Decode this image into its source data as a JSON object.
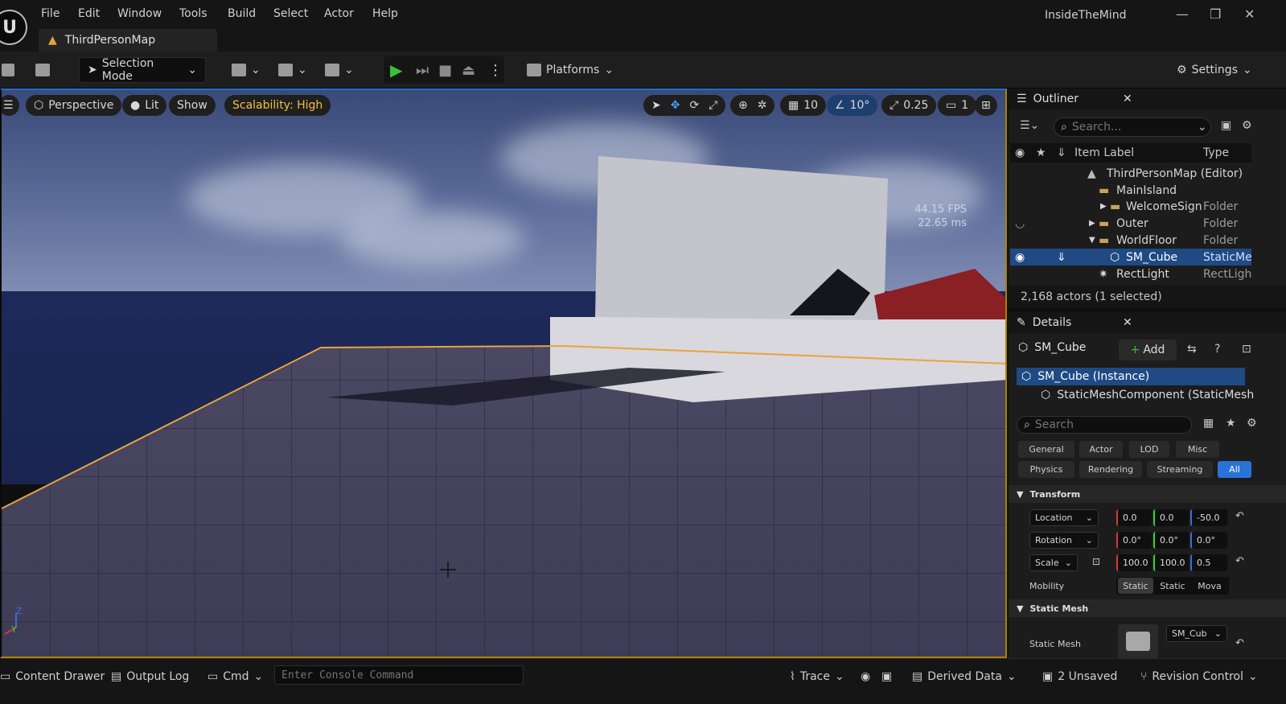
{
  "window": {
    "title": "InsideTheMind",
    "map_tab": "ThirdPersonMap"
  },
  "menu": [
    "File",
    "Edit",
    "Window",
    "Tools",
    "Build",
    "Select",
    "Actor",
    "Help"
  ],
  "toolbar": {
    "selection_mode": "Selection Mode",
    "platforms": "Platforms",
    "settings": "Settings"
  },
  "viewport": {
    "perspective": "Perspective",
    "lit": "Lit",
    "show": "Show",
    "scalability": "Scalability: High",
    "grid_snap": "10",
    "rotation_snap": "10°",
    "scale_snap": "0.25",
    "camera_speed": "1",
    "fps": "44.15 FPS",
    "ms": "22.65 ms",
    "axis_z": "Z",
    "axis_y": "Y"
  },
  "outliner": {
    "title": "Outliner",
    "search_placeholder": "Search...",
    "col_label": "Item Label",
    "col_type": "Type",
    "rows": [
      {
        "label": "ThirdPersonMap (Editor)",
        "type": ""
      },
      {
        "label": "MainIsland",
        "type": ""
      },
      {
        "label": "WelcomeSign",
        "type": "Folder"
      },
      {
        "label": "Outer",
        "type": "Folder"
      },
      {
        "label": "WorldFloor",
        "type": "Folder"
      },
      {
        "label": "SM_Cube",
        "type": "StaticMe"
      },
      {
        "label": "RectLight",
        "type": "RectLigh"
      }
    ],
    "status": "2,168 actors (1 selected)"
  },
  "details": {
    "title": "Details",
    "object": "SM_Cube",
    "add": "Add",
    "instance": "SM_Cube (Instance)",
    "component": "StaticMeshComponent (StaticMesh",
    "search_placeholder": "Search",
    "categories": [
      "General",
      "Actor",
      "LOD",
      "Misc",
      "Physics",
      "Rendering",
      "Streaming",
      "All"
    ],
    "transform_header": "Transform",
    "location_label": "Location",
    "location": [
      "0.0",
      "0.0",
      "-50.0"
    ],
    "rotation_label": "Rotation",
    "rotation": [
      "0.0°",
      "0.0°",
      "0.0°"
    ],
    "scale_label": "Scale",
    "scale": [
      "100.0",
      "100.0",
      "0.5"
    ],
    "mobility_label": "Mobility",
    "mobility": [
      "Static",
      "Static",
      "Mova"
    ],
    "static_mesh_header": "Static Mesh",
    "static_mesh_label": "Static Mesh",
    "static_mesh_value": "SM_Cub"
  },
  "statusbar": {
    "content_drawer": "Content Drawer",
    "output_log": "Output Log",
    "cmd": "Cmd",
    "console_placeholder": "Enter Console Command",
    "trace": "Trace",
    "derived_data": "Derived Data",
    "unsaved": "2 Unsaved",
    "revision_control": "Revision Control"
  }
}
